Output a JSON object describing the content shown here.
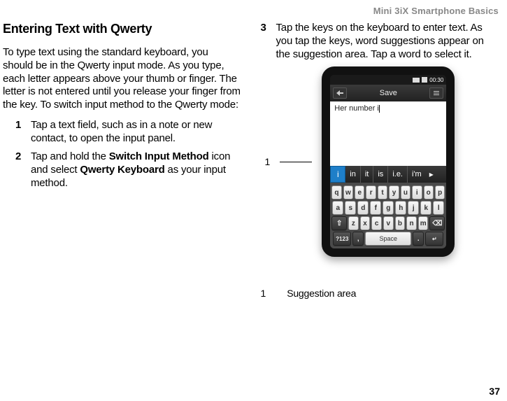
{
  "header": {
    "title": "Mini 3iX Smartphone Basics"
  },
  "left": {
    "heading": "Entering Text with Qwerty",
    "intro": "To type text using the standard keyboard, you should be in the Qwerty input mode. As you type, each letter appears above your thumb or finger. The letter is not entered until you release your finger from the key. To switch input method to the Qwerty mode:",
    "step1_num": "1",
    "step1": "Tap a text field, such as in a note or new contact, to open the input panel.",
    "step2_num": "2",
    "step2_a": "Tap and hold the ",
    "step2_bold1": "Switch Input Method",
    "step2_b": " icon and select ",
    "step2_bold2": "Qwerty Keyboard",
    "step2_c": " as your input method."
  },
  "right": {
    "step3_num": "3",
    "step3": "Tap the keys on the keyboard to enter text. As you tap the keys, word suggestions appear on the suggestion area. Tap a word to select it.",
    "callout_num": "1",
    "footnote_num": "1",
    "footnote_text": "Suggestion area"
  },
  "phone": {
    "status_time": "00:30",
    "titlebar_label": "Save",
    "entered_text": "Her number i",
    "suggestions": {
      "selected": "i",
      "items": [
        "in",
        "it",
        "is",
        "i.e.",
        "i'm"
      ]
    },
    "keyboard": {
      "row1": [
        "q",
        "w",
        "e",
        "r",
        "t",
        "y",
        "u",
        "i",
        "o",
        "p"
      ],
      "row2": [
        "a",
        "s",
        "d",
        "f",
        "g",
        "h",
        "j",
        "k",
        "l"
      ],
      "row3_shift": "⇧",
      "row3": [
        "z",
        "x",
        "c",
        "v",
        "b",
        "n",
        "m"
      ],
      "row3_del": "⌫",
      "row4_mode": "?123",
      "row4_comma": ",",
      "row4_space": "Space",
      "row4_period": ".",
      "row4_enter": "↵"
    }
  },
  "page_number": "37"
}
